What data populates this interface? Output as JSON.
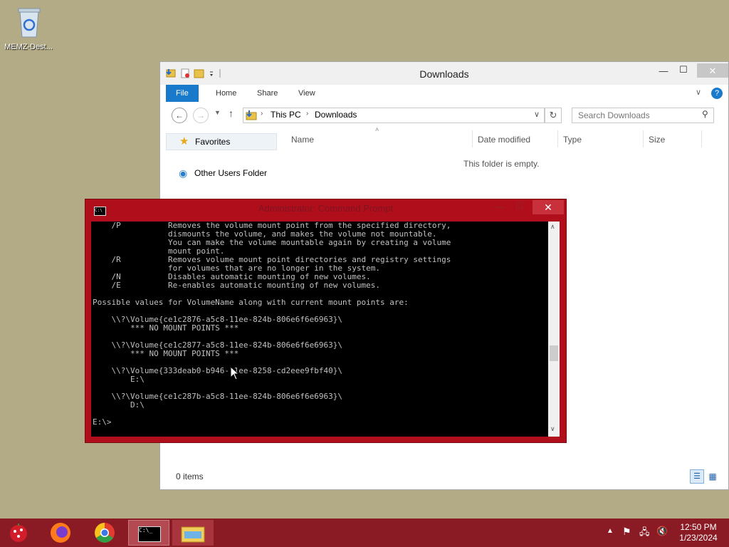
{
  "desktop": {
    "icon_label": "MEMZ-Dest..."
  },
  "explorer": {
    "title": "Downloads",
    "ribbon_tabs": [
      "File",
      "Home",
      "Share",
      "View"
    ],
    "breadcrumb": [
      "This PC",
      "Downloads"
    ],
    "search_placeholder": "Search Downloads",
    "nav": {
      "favorites": "Favorites",
      "other_users": "Other Users Folder"
    },
    "columns": [
      "Name",
      "Date modified",
      "Type",
      "Size"
    ],
    "empty_text": "This folder is empty.",
    "status": "0 items"
  },
  "cmd": {
    "title": "Administrator: Command Prompt",
    "output": "    /P          Removes the volume mount point from the specified directory,\n                dismounts the volume, and makes the volume not mountable.\n                You can make the volume mountable again by creating a volume\n                mount point.\n    /R          Removes volume mount point directories and registry settings\n                for volumes that are no longer in the system.\n    /N          Disables automatic mounting of new volumes.\n    /E          Re-enables automatic mounting of new volumes.\n\nPossible values for VolumeName along with current mount points are:\n\n    \\\\?\\Volume{ce1c2876-a5c8-11ee-824b-806e6f6e6963}\\\n        *** NO MOUNT POINTS ***\n\n    \\\\?\\Volume{ce1c2877-a5c8-11ee-824b-806e6f6e6963}\\\n        *** NO MOUNT POINTS ***\n\n    \\\\?\\Volume{333deab0-b946-11ee-8258-cd2eee9fbf40}\\\n        E:\\\n\n    \\\\?\\Volume{ce1c287b-a5c8-11ee-824b-806e6f6e6963}\\\n        D:\\\n\nE:\\>"
  },
  "taskbar": {
    "time": "12:50 PM",
    "date": "1/23/2024"
  },
  "colors": {
    "ribbon_file": "#1979ca",
    "cmd_frame": "#b10e1c",
    "taskbar": "#8a1a24"
  }
}
